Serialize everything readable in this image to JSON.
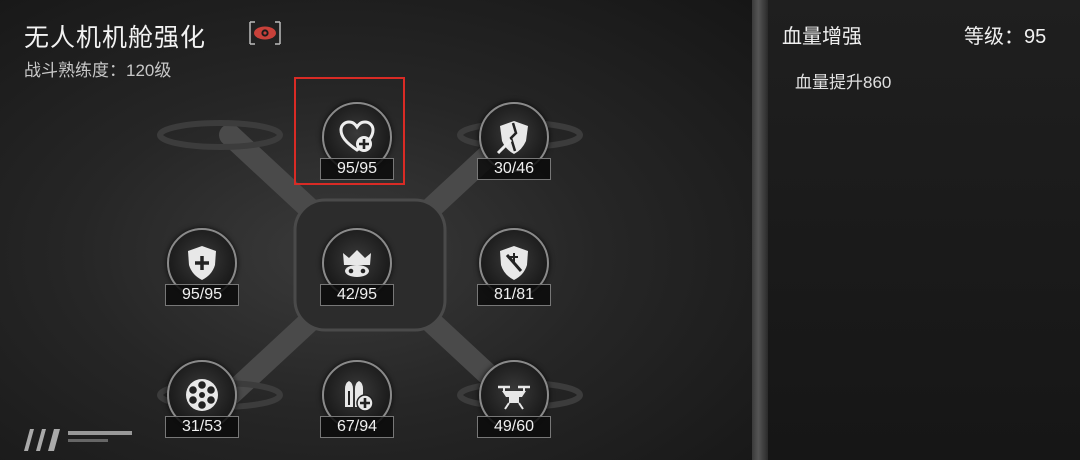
{
  "header": {
    "title": "无人机机舱强化",
    "subtitle": "战斗熟练度：120级"
  },
  "nodes": [
    {
      "level": "95/95",
      "icon": "heart-plus-icon",
      "selected": true
    },
    {
      "level": "30/46",
      "icon": "broken-shield-sword-icon"
    },
    {
      "level": "95/95",
      "icon": "shield-plus-icon"
    },
    {
      "level": "42/95",
      "icon": "drone-crown-icon"
    },
    {
      "level": "81/81",
      "icon": "shield-slash-icon"
    },
    {
      "level": "31/53",
      "icon": "cylinder-magazine-icon"
    },
    {
      "level": "67/94",
      "icon": "ammo-plus-icon"
    },
    {
      "level": "49/60",
      "icon": "drone-icon"
    }
  ],
  "detail": {
    "title": "血量增强",
    "level": "等级：95",
    "description": "血量提升860"
  },
  "colors": {
    "selection": "#d92b25",
    "eye_icon": "#c8413a"
  }
}
